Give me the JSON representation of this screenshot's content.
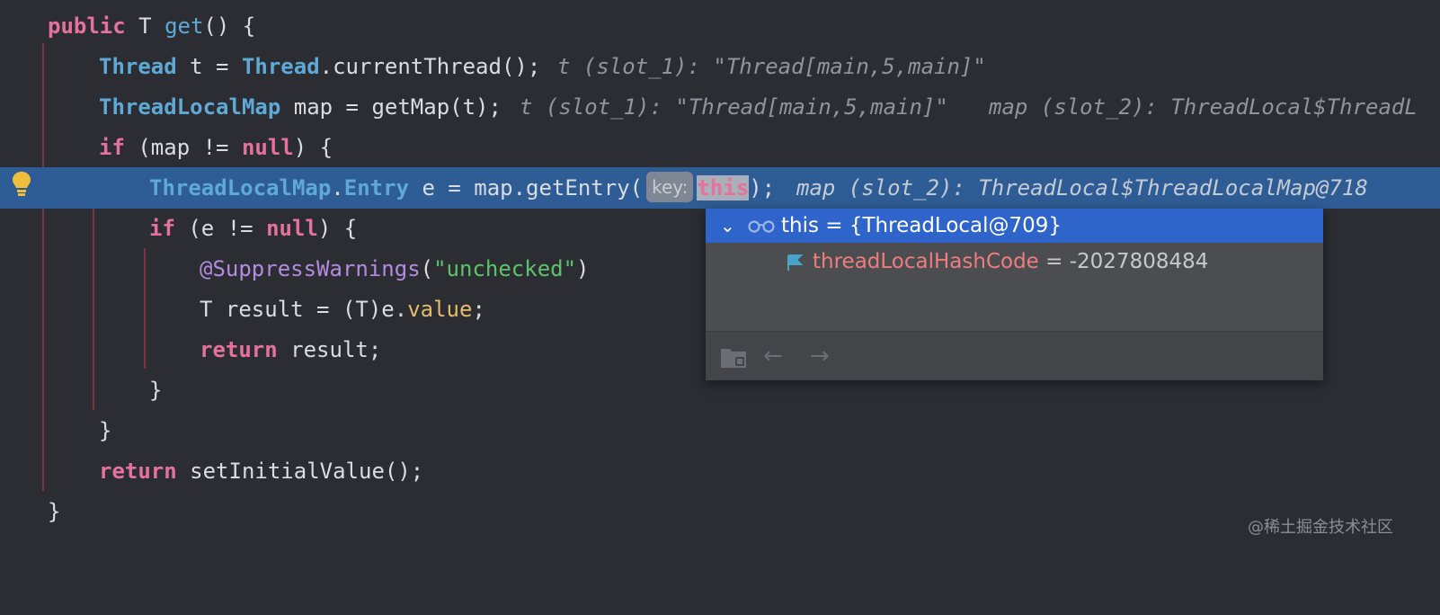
{
  "code": {
    "l1": {
      "kw": "public",
      "t1": " T ",
      "fn": "get",
      "t2": "() {"
    },
    "l2": {
      "type1": "Thread",
      "t1": " t = ",
      "type2": "Thread",
      "t2": ".currentThread();",
      "inline": "t (slot_1): \"Thread[main,5,main]\""
    },
    "l3": {
      "type1": "ThreadLocalMap",
      "t1": " map = getMap(t);",
      "inline1": "t (slot_1): \"Thread[main,5,main]\"",
      "inline2": "map (slot_2): ThreadLocal$ThreadL"
    },
    "l4": {
      "kw1": "if",
      "t1": " (map != ",
      "kw2": "null",
      "t2": ") {"
    },
    "l5": {
      "type1": "ThreadLocalMap",
      "t1": ".",
      "type2": "Entry",
      "t2": " e = map.getEntry(",
      "hint": "key:",
      "arg": "this",
      "t3": ");",
      "inline": "map (slot_2): ThreadLocal$ThreadLocalMap@718"
    },
    "l6": {
      "kw1": "if",
      "t1": " (e != ",
      "kw2": "null",
      "t2": ") {"
    },
    "l7": {
      "ann": "@SuppressWarnings",
      "t1": "(",
      "str": "\"unchecked\"",
      "t2": ")"
    },
    "l8": {
      "t1": "T result = (T)e.",
      "field": "value",
      "t2": ";"
    },
    "l9": {
      "kw": "return",
      "t1": " result;"
    },
    "l10": {
      "t1": "}"
    },
    "l11": {
      "t1": "}"
    },
    "l12": {
      "kw": "return",
      "t1": " setInitialValue();"
    },
    "l13": {
      "t1": "}"
    }
  },
  "popup": {
    "selected": "this = {ThreadLocal@709}",
    "child_name": "threadLocalHashCode",
    "child_value": " = -2027808484"
  },
  "watermark": "@稀土掘金技术社区",
  "colors": {
    "background": "#2b2d33",
    "highlight_line": "#2e5c94",
    "popup_selection": "#2f65ca",
    "keyword": "#e4729a",
    "type": "#5fa9d6",
    "string": "#5ec26a"
  }
}
